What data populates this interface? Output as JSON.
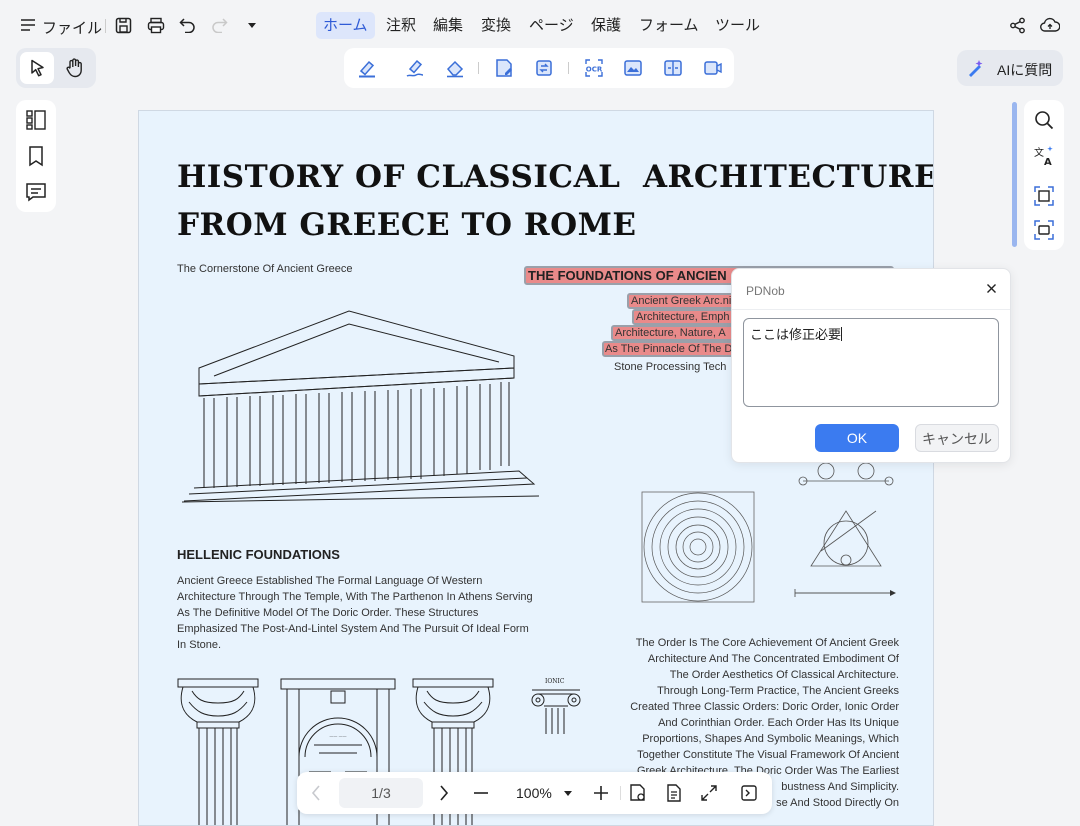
{
  "menu": {
    "file_label": "ファイル",
    "tabs": [
      "ホーム",
      "注釈",
      "編集",
      "変換",
      "ページ",
      "保護",
      "フォーム",
      "ツール"
    ]
  },
  "ai_button_label": "AIに質問",
  "document": {
    "title_line1": "HISTORY OF CLASSICAL  ARCHITECTURE:",
    "title_line2": "FROM GREECE TO ROME",
    "subtitle": "The Cornerstone Of Ancient Greece",
    "foundations_heading": "THE FOUNDATIONS OF ANCIEN",
    "highlight_lines": [
      "Ancient Greek Arc.ni",
      "Architecture, Emph",
      "Architecture, Nature, A",
      "As The Pinnacle Of The D"
    ],
    "stone_line": "Stone Processing Tech",
    "hellenic_heading": "HELLENIC FOUNDATIONS",
    "hellenic_body": [
      "Ancient Greece Established The Formal Language Of Western",
      "Architecture Through The Temple, With The Parthenon In Athens Serving",
      "As The Definitive Model Of The Doric Order. These Structures",
      "Emphasized The Post-And-Lintel System And The Pursuit Of Ideal Form",
      "In Stone."
    ],
    "order_body": [
      "The Order Is The Core Achievement Of Ancient Greek",
      "Architecture And The Concentrated Embodiment Of",
      "The Order Aesthetics Of Classical Architecture.",
      "Through Long-Term Practice, The Ancient Greeks",
      "Created Three Classic Orders: Doric Order, Ionic Order",
      "And Corinthian Order. Each Order Has Its Unique",
      "Proportions, Shapes And Symbolic Meanings, Which",
      "Together Constitute The Visual Framework Of Ancient",
      "Greek Architecture. The Doric Order Was The Earliest",
      "bustness And Simplicity.",
      "se And Stood Directly On"
    ],
    "ionic_label": "IONIC"
  },
  "dialog": {
    "title": "PDNob",
    "text": "ここは修正必要",
    "ok_label": "OK",
    "cancel_label": "キャンセル"
  },
  "bottom": {
    "page_indicator": "1/3",
    "zoom": "100%"
  },
  "colors": {
    "accent": "#3b7bf0",
    "highlight": "#e98a8a",
    "page_bg": "#e8f3fd"
  }
}
